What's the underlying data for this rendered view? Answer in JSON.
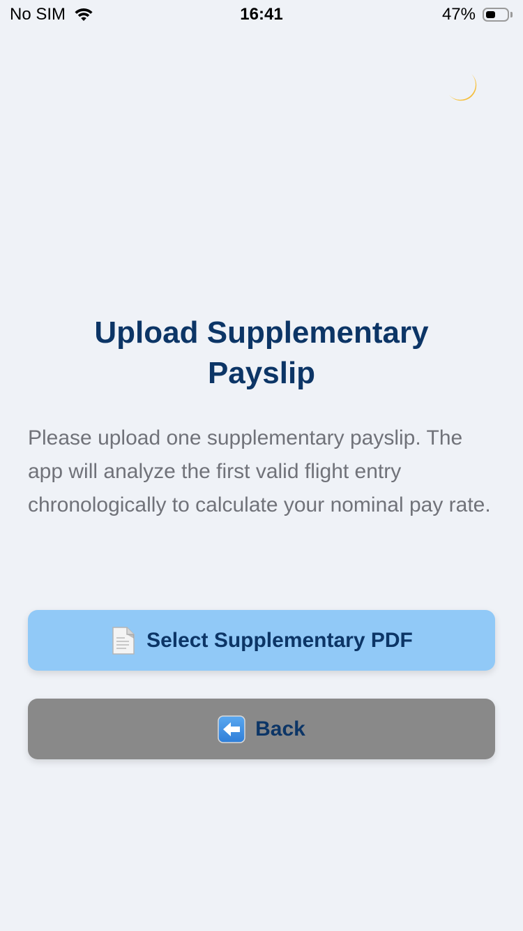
{
  "status_bar": {
    "carrier": "No SIM",
    "time": "16:41",
    "battery_percent": "47%",
    "battery_level": 0.47
  },
  "theme_toggle": {
    "icon": "crescent-moon-icon",
    "color": "#f5c94a"
  },
  "main": {
    "title": "Upload Supplementary Payslip",
    "description": "Please upload one supplementary payslip. The app will analyze the first valid flight entry chronologically to calculate your nominal pay rate."
  },
  "buttons": {
    "select_pdf": {
      "label": "Select Supplementary PDF",
      "icon": "document-icon",
      "color": "#91c9f7"
    },
    "back": {
      "label": "Back",
      "icon": "left-arrow-icon",
      "color": "#898989"
    }
  },
  "colors": {
    "background": "#eff2f7",
    "title": "#0c3566",
    "text": "#707279"
  }
}
